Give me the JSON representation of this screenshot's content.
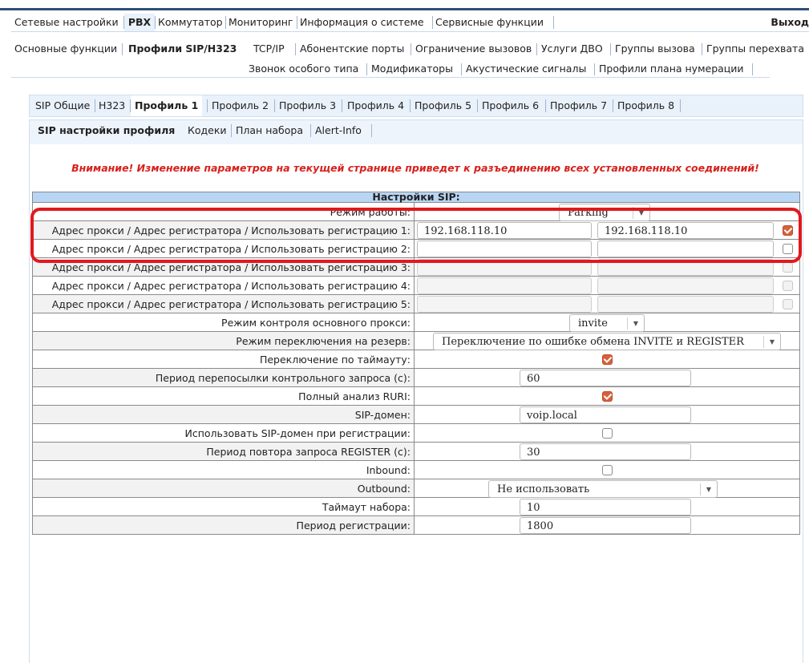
{
  "top_menu": {
    "items": [
      "Сетевые настройки",
      "PBX",
      "Коммутатор",
      "Мониторинг",
      "Информация о системе",
      "Сервисные функции"
    ],
    "active": "PBX",
    "exit_label": "Выход"
  },
  "sub_menu": {
    "row1": [
      "Основные функции",
      "Профили SIP/H323",
      "TCP/IP",
      "Абонентские порты",
      "Ограничение вызовов",
      "Услуги ДВО",
      "Группы вызова",
      "Группы перехвата"
    ],
    "row2": [
      "Звонок особого типа",
      "Модификаторы",
      "Акустические сигналы",
      "Профили плана нумерации"
    ],
    "active": "Профили SIP/H323"
  },
  "profile_tabs": {
    "items": [
      "SIP Общие",
      "H323",
      "Профиль 1",
      "Профиль 2",
      "Профиль 3",
      "Профиль 4",
      "Профиль 5",
      "Профиль 6",
      "Профиль 7",
      "Профиль 8"
    ],
    "active": "Профиль 1"
  },
  "settings_tabs": {
    "items": [
      "SIP настройки профиля",
      "Кодеки",
      "План набора",
      "Alert-Info"
    ],
    "active": "SIP настройки профиля"
  },
  "warning": "Внимание! Изменение параметров на текущей странице приведет к разъединению всех установленных соединений!",
  "table": {
    "title": "Настройки SIP:",
    "mode": {
      "label": "Режим работы:",
      "value": "Parking"
    },
    "registrations": [
      {
        "label": "Адрес прокси / Адрес регистратора / Использовать регистрацию 1:",
        "proxy": "192.168.118.10",
        "registrar": "192.168.118.10",
        "checked": true
      },
      {
        "label": "Адрес прокси / Адрес регистратора / Использовать регистрацию 2:",
        "proxy": "",
        "registrar": "",
        "checked": false
      },
      {
        "label": "Адрес прокси / Адрес регистратора / Использовать регистрацию 3:",
        "proxy": "",
        "registrar": "",
        "checked": false
      },
      {
        "label": "Адрес прокси / Адрес регистратора / Использовать регистрацию 4:",
        "proxy": "",
        "registrar": "",
        "checked": false
      },
      {
        "label": "Адрес прокси / Адрес регистратора / Использовать регистрацию 5:",
        "proxy": "",
        "registrar": "",
        "checked": false
      }
    ],
    "proxy_control": {
      "label": "Режим контроля основного прокси:",
      "value": "invite"
    },
    "failover_mode": {
      "label": "Режим переключения на резерв:",
      "value": "Переключение по ошибке обмена INVITE и REGISTER"
    },
    "timeout_switch": {
      "label": "Переключение по таймауту:",
      "checked": true
    },
    "keepalive_period": {
      "label": "Период перепосылки контрольного запроса (с):",
      "value": "60"
    },
    "full_ruri": {
      "label": "Полный анализ RURI:",
      "checked": true
    },
    "sip_domain": {
      "label": "SIP-домен:",
      "value": "voip.local"
    },
    "use_domain_reg": {
      "label": "Использовать SIP-домен при регистрации:",
      "checked": false
    },
    "register_retry": {
      "label": "Период повтора запроса REGISTER (с):",
      "value": "30"
    },
    "inbound": {
      "label": "Inbound:",
      "checked": false
    },
    "outbound": {
      "label": "Outbound:",
      "value": "Не использовать"
    },
    "dial_timeout": {
      "label": "Таймаут набора:",
      "value": "10"
    },
    "reg_period": {
      "label": "Период регистрации:",
      "value": "1800"
    }
  }
}
